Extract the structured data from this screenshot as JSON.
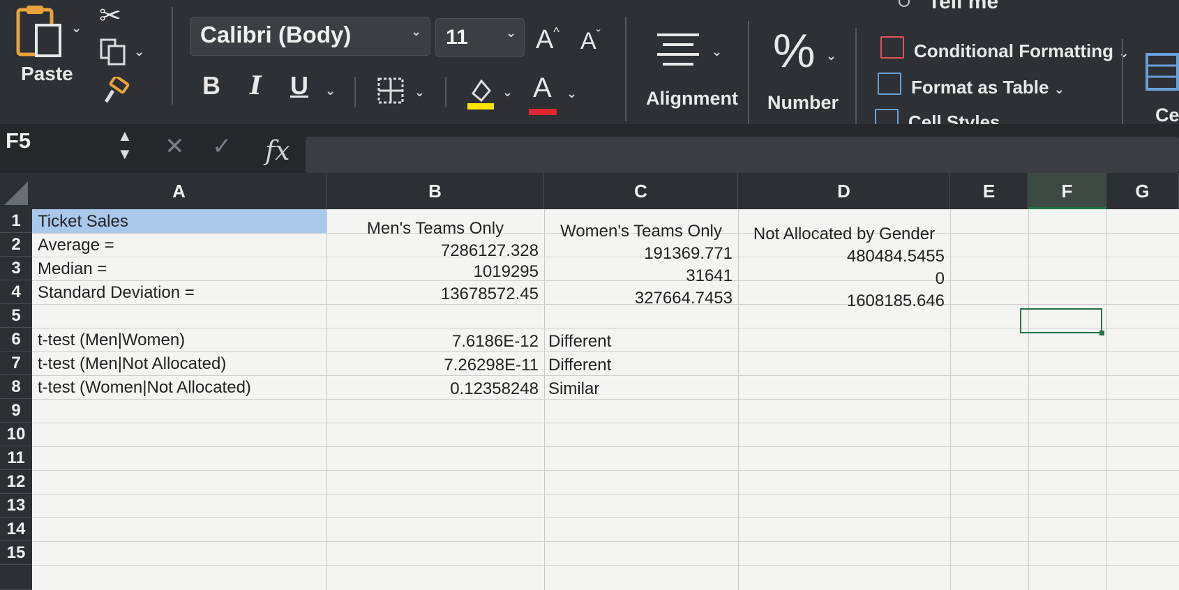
{
  "ribbon": {
    "tell_me": "Tell me",
    "paste_label": "Paste",
    "font_name": "Calibri (Body)",
    "font_size": "11",
    "bold": "B",
    "italic": "I",
    "underline": "U",
    "font_color_glyph": "A",
    "grow_glyph": "A",
    "shrink_glyph": "A",
    "alignment_label": "Alignment",
    "number_label": "Number",
    "number_glyph": "%",
    "conditional_formatting": "Conditional Formatting",
    "format_as_table": "Format as Table",
    "cell_styles": "Cell Styles",
    "cells_label": "Cel",
    "highlight_color": "#ffe600",
    "font_color": "#e0262f"
  },
  "formula_bar": {
    "name_box": "F5",
    "fx": "fx",
    "content": ""
  },
  "grid": {
    "columns": [
      "A",
      "B",
      "C",
      "D",
      "E",
      "F",
      "G"
    ],
    "selected_column": "F",
    "rows": [
      "1",
      "2",
      "3",
      "4",
      "5",
      "6",
      "7",
      "8",
      "9",
      "10",
      "11",
      "12",
      "13",
      "14",
      "15"
    ],
    "cells": {
      "A1": "Ticket Sales",
      "A2": "Average =",
      "A3": "Median =",
      "A4": "Standard Deviation =",
      "A6": "t-test (Men|Women)",
      "A7": "t-test (Men|Not Allocated)",
      "A8": "t-test (Women|Not Allocated)",
      "B1": "Men's Teams Only",
      "B2": "7286127.328",
      "B3": "1019295",
      "B4": "13678572.45",
      "B6": "7.6186E-12",
      "B7": "7.26298E-11",
      "B8": "0.12358248",
      "C1": "Women's Teams Only",
      "C2": "191369.771",
      "C3": "31641",
      "C4": "327664.7453",
      "C6": "Different",
      "C7": "Different",
      "C8": "Similar",
      "D1": "Not Allocated by Gender",
      "D2": "480484.5455",
      "D3": "0",
      "D4": "1608185.646"
    }
  }
}
